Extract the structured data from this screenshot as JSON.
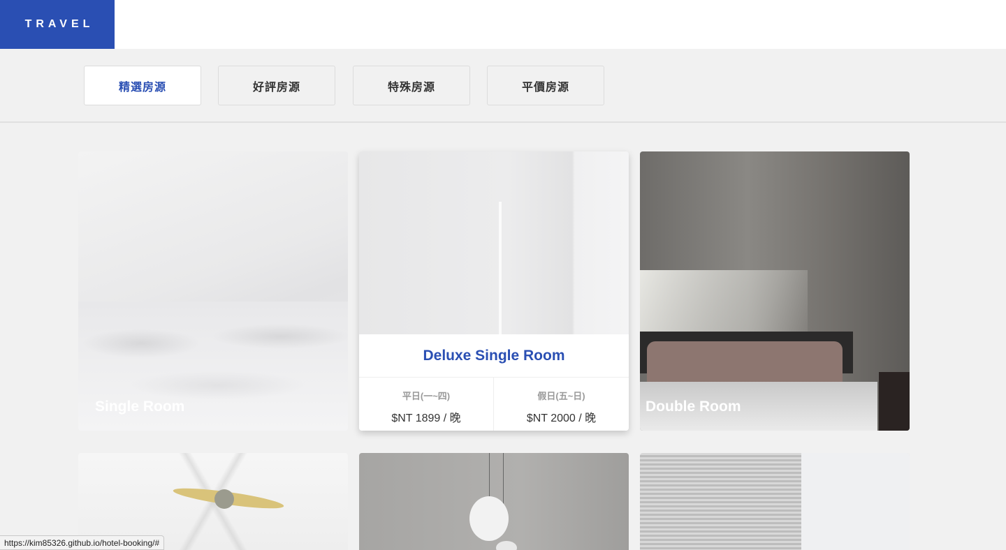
{
  "header": {
    "logo": "TRAVEL"
  },
  "tabs": [
    {
      "label": "精選房源",
      "active": true
    },
    {
      "label": "好評房源",
      "active": false
    },
    {
      "label": "特殊房源",
      "active": false
    },
    {
      "label": "平價房源",
      "active": false
    }
  ],
  "rooms": [
    {
      "title": "Single Room"
    },
    {
      "title": "Deluxe Single Room",
      "weekday_label": "平日(一~四)",
      "weekday_price": "$NT 1899 / 晚",
      "holiday_label": "假日(五~日)",
      "holiday_price": "$NT 2000 / 晚"
    },
    {
      "title": "Double Room"
    }
  ],
  "status_bar": {
    "url": "https://kim85326.github.io/hotel-booking/#"
  },
  "colors": {
    "brand": "#2a4fb3"
  }
}
